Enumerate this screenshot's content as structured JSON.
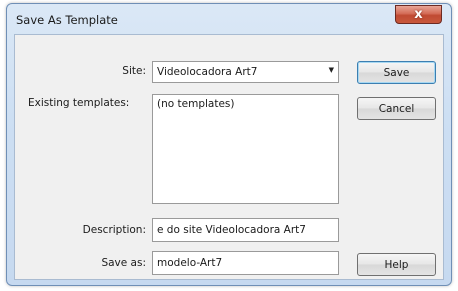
{
  "window": {
    "title": "Save As Template",
    "close_glyph": "x",
    "close_icon": "close-icon"
  },
  "form": {
    "site_label": "Site:",
    "site_value": "Videolocadora Art7",
    "site_dropdown_icon": "dropdown-arrow-icon",
    "site_dropdown_glyph": "▼",
    "existing_label": "Existing templates:",
    "existing_items": [
      "(no templates)"
    ],
    "description_label": "Description:",
    "description_value": "e do site Videolocadora Art7",
    "saveas_label": "Save as:",
    "saveas_value": "modelo-Art7"
  },
  "buttons": {
    "save": "Save",
    "cancel": "Cancel",
    "help": "Help"
  },
  "colors": {
    "title_bar": "#cddff3",
    "close_button": "#c8583c",
    "default_button_border": "#3c7fb1"
  }
}
